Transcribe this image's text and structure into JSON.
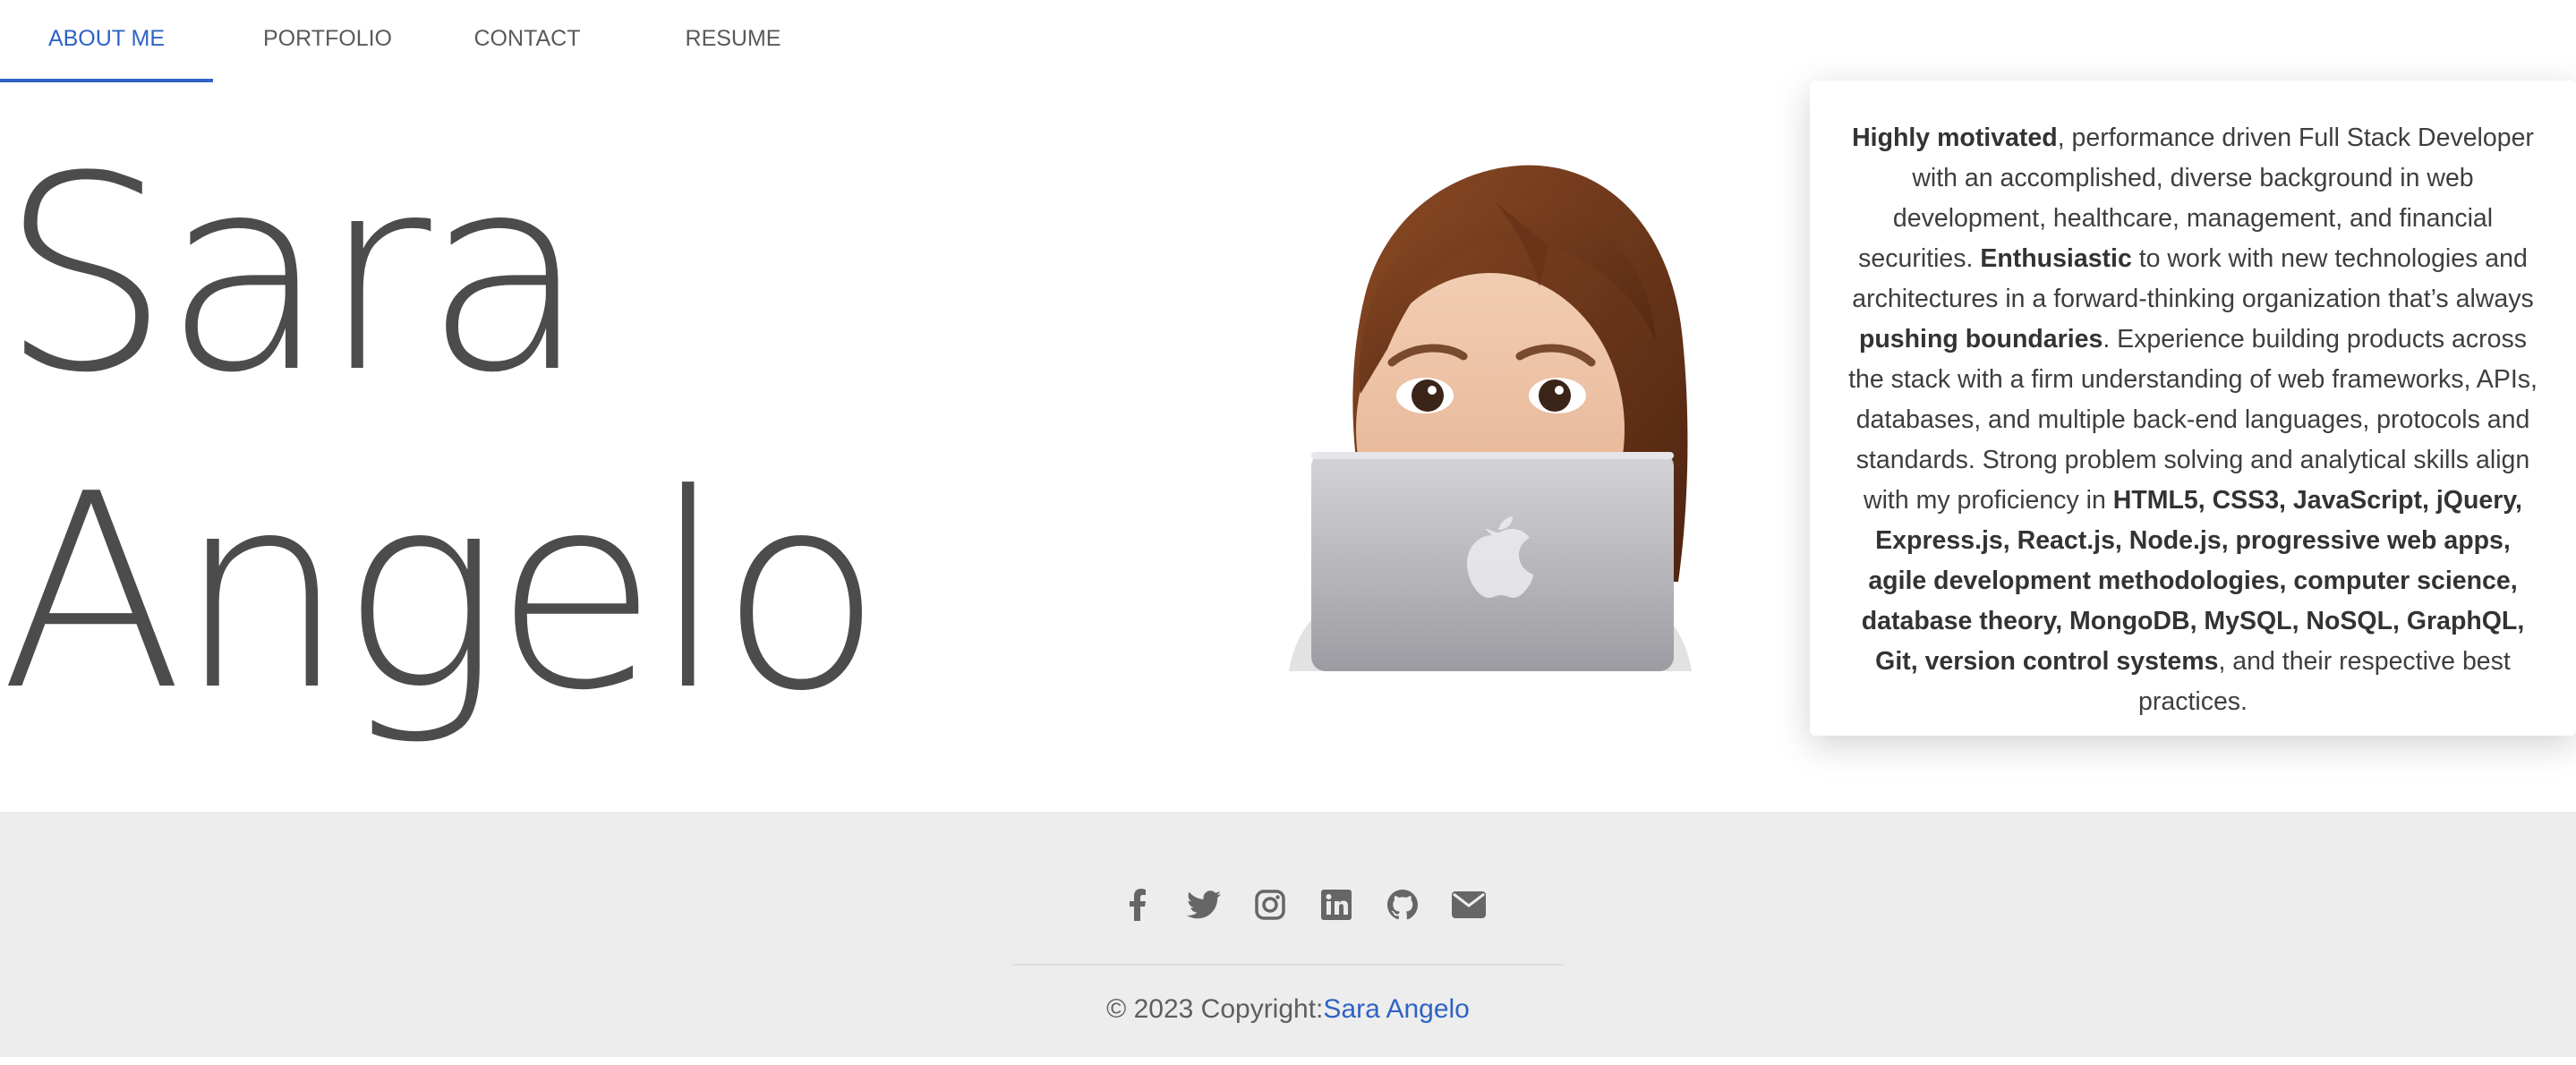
{
  "nav": {
    "tabs": [
      {
        "label": "ABOUT ME",
        "active": true
      },
      {
        "label": "PORTFOLIO",
        "active": false
      },
      {
        "label": "CONTACT",
        "active": false
      },
      {
        "label": "RESUME",
        "active": false
      }
    ]
  },
  "hero": {
    "first_name": "Sara",
    "last_name": "Angelo"
  },
  "about": {
    "p1_bold": "Highly motivated",
    "p1": ", performance driven Full Stack Developer with an accomplished, diverse background in web development, healthcare, management, and financial securities. ",
    "p2_bold": "Enthusiastic",
    "p2": " to work with new technologies and architectures in a forward-thinking organization that’s always ",
    "p3_bold": "pushing boundaries",
    "p3": ". Experience building products across the stack with a firm understanding of web frameworks, APIs, databases, and multiple back-end languages, protocols and standards. Strong problem solving and analytical skills align with my proficiency in ",
    "p4_bold": "HTML5, CSS3, JavaScript, jQuery, Express.js, React.js, Node.js, progressive web apps, agile development methodologies, computer science, database theory, MongoDB, MySQL, NoSQL, GraphQL, Git, version control systems",
    "p4": ", and their respective best practices."
  },
  "footer": {
    "socials": [
      "facebook-icon",
      "twitter-icon",
      "instagram-icon",
      "linkedin-icon",
      "github-icon",
      "envelope-icon"
    ],
    "copyright": "© 2023 Copyright:",
    "copyright_name": "Sara Angelo"
  },
  "colors": {
    "accent": "#2f63c4",
    "footer_bg": "#ededed",
    "text": "#4a4a4a"
  }
}
